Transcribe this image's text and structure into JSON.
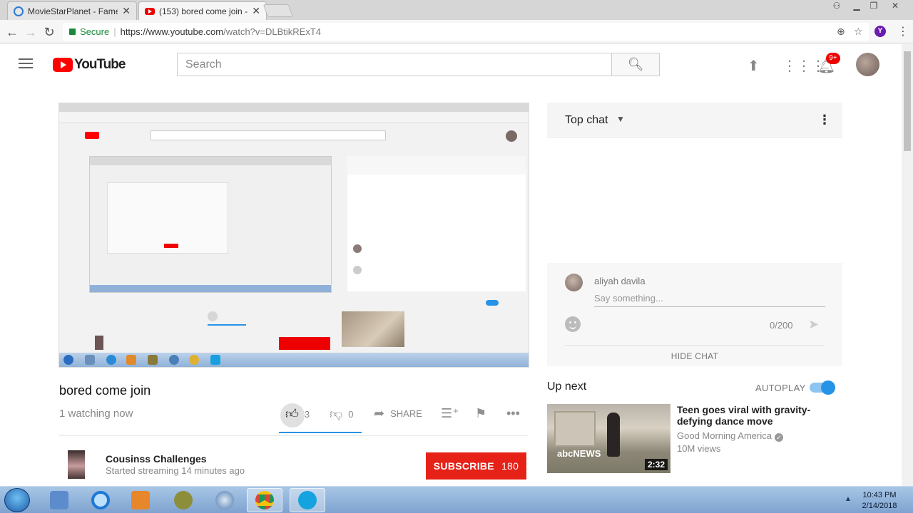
{
  "browser": {
    "tabs": [
      {
        "title": "MovieStarPlanet - Fame",
        "active": false
      },
      {
        "title": "(153) bored come join -",
        "active": true
      }
    ],
    "secure_label": "Secure",
    "url_host": "https://www.youtube.com",
    "url_path": "/watch?v=DLBtikRExT4",
    "profile_letter": "Y"
  },
  "header": {
    "logo_text": "YouTube",
    "search_placeholder": "Search",
    "notification_count": "9+"
  },
  "video": {
    "title": "bored come join",
    "watching": "1 watching now",
    "likes": "3",
    "dislikes": "0",
    "share_label": "SHARE",
    "channel_name": "Cousinss Challenges",
    "channel_sub": "Started streaming 14 minutes ago",
    "subscribe_label": "SUBSCRIBE",
    "subscriber_count": "180"
  },
  "chat": {
    "title": "Top chat",
    "author": "aliyah davila",
    "input_placeholder": "Say something...",
    "char_count": "0/200",
    "hide_label": "HIDE CHAT"
  },
  "up_next": {
    "heading": "Up next",
    "autoplay_label": "AUTOPLAY",
    "autoplay_on": true,
    "video_title": "Teen goes viral with gravity-defying dance move",
    "channel": "Good Morning America",
    "views": "10M views",
    "duration": "2:32",
    "thumb_watermark": "abcNEWS"
  },
  "taskbar": {
    "time": "10:43 PM",
    "date": "2/14/2018"
  },
  "colors": {
    "youtube_red": "#e62117",
    "accent_blue": "#2793e6"
  }
}
